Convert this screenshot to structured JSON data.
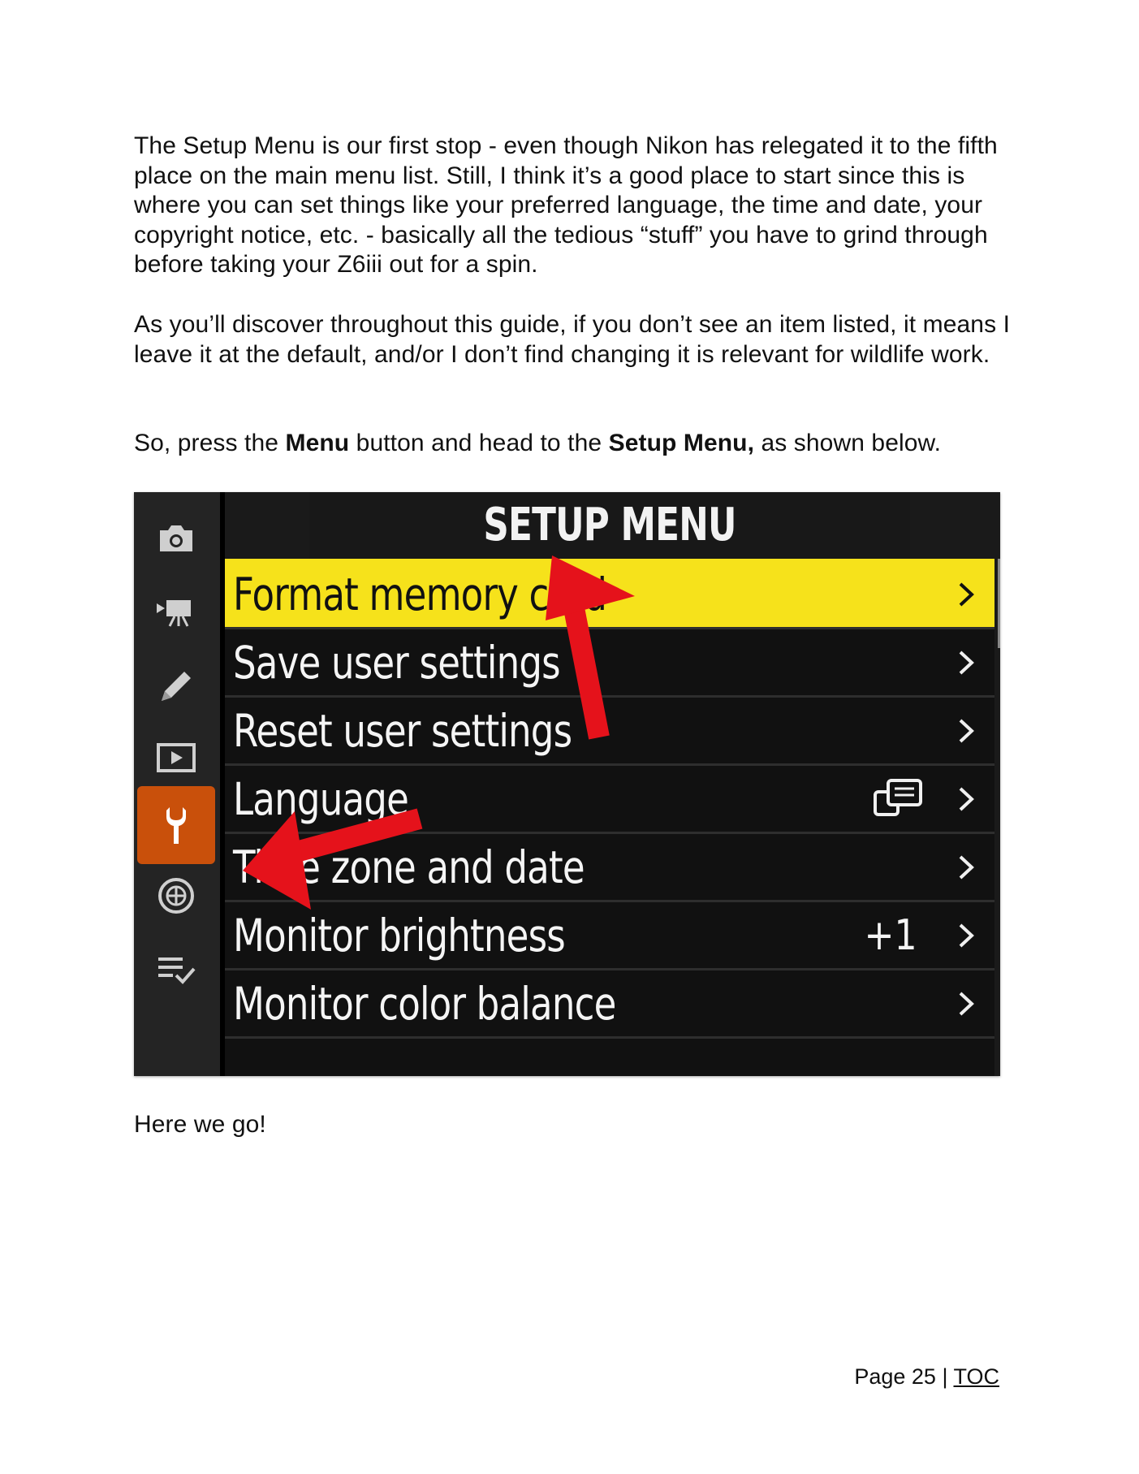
{
  "paragraphs": {
    "p1": "The Setup Menu is our first stop - even though Nikon has relegated it to the fifth place on the main menu list. Still, I think it’s a good place to start since this is where you can set things like your preferred language, the time and date, your copyright notice, etc. - basically all the tedious “stuff” you have to grind through before taking your Z6iii out for a spin.",
    "p2": "As you’ll discover throughout this guide, if you don’t see an item listed, it means I leave it at the default, and/or I don’t find changing it is relevant for wildlife work.",
    "p3_prefix": "So, press the ",
    "p3_bold1": "Menu",
    "p3_mid": " button and head to the ",
    "p3_bold2": "Setup Menu,",
    "p3_suffix": " as shown below.",
    "p4": "Here we go!"
  },
  "camera_screen": {
    "title": "SETUP MENU",
    "sidebar_icons": [
      "camera-icon",
      "movie-camera-icon",
      "pencil-icon",
      "playback-icon",
      "wrench-icon",
      "network-icon",
      "my-menu-icon"
    ],
    "selected_sidebar": "wrench-icon",
    "rows": [
      {
        "label": "Format memory card",
        "value": "",
        "selected": true
      },
      {
        "label": "Save user settings",
        "value": "",
        "selected": false
      },
      {
        "label": "Reset user settings",
        "value": "",
        "selected": false
      },
      {
        "label": "Language",
        "value": "",
        "icon": "language-icon",
        "selected": false
      },
      {
        "label": "Time zone and date",
        "value": "",
        "selected": false
      },
      {
        "label": "Monitor brightness",
        "value": "+1",
        "selected": false
      },
      {
        "label": "Monitor color balance",
        "value": "",
        "selected": false
      }
    ],
    "colors": {
      "selected_row": "#f6e21b",
      "setup_tab": "#c9500b",
      "arrow": "#e5121b"
    }
  },
  "footer": {
    "page_label": "Page 25 | ",
    "toc_link": "TOC"
  }
}
